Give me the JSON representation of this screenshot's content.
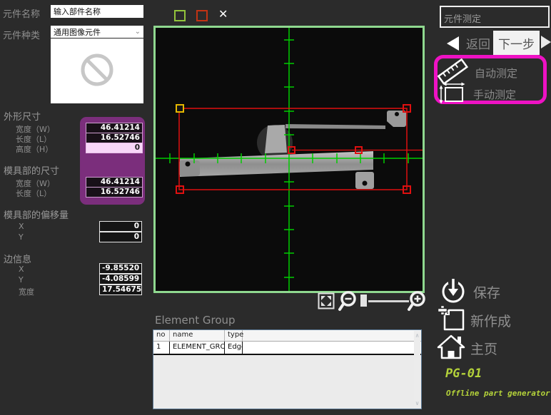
{
  "left": {
    "name_label": "元件名称",
    "name_value": "输入部件名称",
    "type_label": "元件种类",
    "type_value": "通用图像元件",
    "outer": {
      "title": "外形尺寸",
      "rows": [
        {
          "label": "宽度（W）",
          "value": "46.41214"
        },
        {
          "label": "长度（L）",
          "value": "16.52746"
        },
        {
          "label": "高度（H）",
          "value": "0"
        }
      ]
    },
    "mold": {
      "title": "模具部的尺寸",
      "rows": [
        {
          "label": "宽度（W）",
          "value": "46.41214"
        },
        {
          "label": "长度（L）",
          "value": "16.52746"
        }
      ]
    },
    "offset": {
      "title": "模具部的偏移量",
      "rows": [
        {
          "label": "X",
          "value": "0"
        },
        {
          "label": "Y",
          "value": "0"
        }
      ]
    },
    "edge": {
      "title": "边信息",
      "rows": [
        {
          "label": "X",
          "value": "-9.85520"
        },
        {
          "label": "Y",
          "value": "-4.08599"
        },
        {
          "label": "宽度",
          "value": "17.54675"
        }
      ]
    }
  },
  "viewer": {
    "close_glyph": "✕"
  },
  "table": {
    "title": "Element Group",
    "columns": [
      "no",
      "name",
      "type"
    ],
    "rows": [
      {
        "no": "1",
        "name": "ELEMENT_GROUP",
        "type": "Edge"
      }
    ]
  },
  "right": {
    "measure_title": "元件测定",
    "back": "返回",
    "next": "下一步",
    "auto": "自动测定",
    "manual": "手动测定",
    "save": "保存",
    "new": "新作成",
    "home": "主页",
    "brand": "PG-01",
    "tagline": "Offline part generator"
  },
  "icons": {
    "dropdown_chevron": "⌄",
    "scroll_up": "∧",
    "scroll_down": "∨"
  },
  "colors": {
    "accent_magenta": "#ee12c4",
    "panel_purple": "#7b2e7c",
    "viewer_border": "#8fd88f",
    "crosshair_green": "#00cc00",
    "roi_red": "#e01010",
    "handle_yellow": "#e5b800",
    "brand_green": "#b4d23a",
    "field_highlight": "#f8d6f8"
  }
}
